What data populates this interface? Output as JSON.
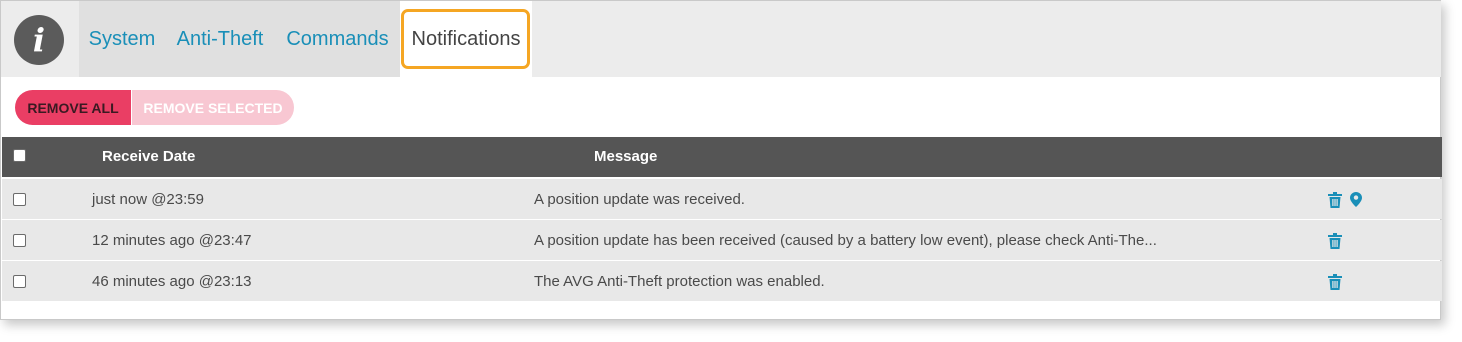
{
  "tabs": [
    {
      "label": "System"
    },
    {
      "label": "Anti-Theft"
    },
    {
      "label": "Commands"
    },
    {
      "label": "Notifications",
      "active": true
    }
  ],
  "info_badge": {
    "glyph": "i",
    "icon": "info-icon"
  },
  "toolbar": {
    "remove_all_label": "REMOVE ALL",
    "remove_selected_label": "REMOVE SELECTED"
  },
  "table": {
    "columns": [
      "Receive Date",
      "Message"
    ],
    "rows": [
      {
        "date": "just now @23:59",
        "message": "A position update was received.",
        "actions": [
          "trash-icon",
          "location-pin-icon"
        ]
      },
      {
        "date": "12 minutes ago @23:47",
        "message": "A position update has been received (caused by a battery low event), please check Anti-The...",
        "actions": [
          "trash-icon"
        ]
      },
      {
        "date": "46 minutes ago @23:13",
        "message": "The AVG Anti-Theft protection was enabled.",
        "actions": [
          "trash-icon"
        ]
      }
    ]
  },
  "colors": {
    "accent": "#1a8fb8",
    "danger": "#ea3e64",
    "danger_disabled": "#f8c7d2",
    "header_bg": "#555555",
    "highlight": "#f5a623"
  }
}
